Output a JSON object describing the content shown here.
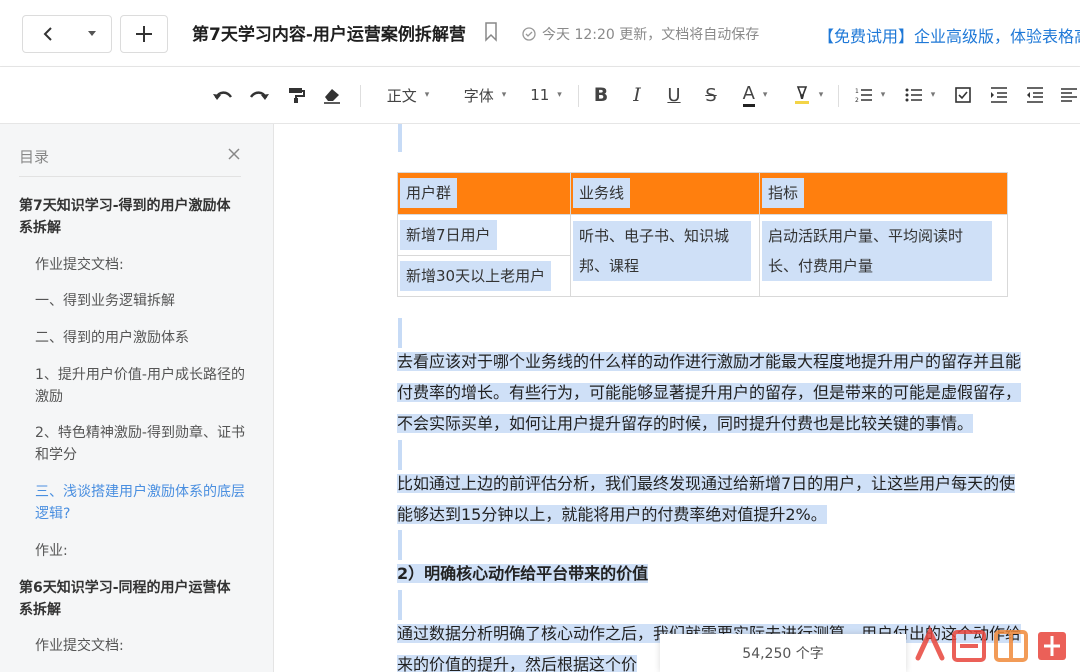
{
  "header": {
    "doc_title": "第7天学习内容-用户运营案例拆解营",
    "save_status": "今天 12:20 更新，文档将自动保存",
    "promo": "【免费试用】企业高级版，体验表格高"
  },
  "toolbar": {
    "style_label": "正文",
    "font_label": "字体",
    "size_label": "11",
    "bold": "B",
    "italic": "I",
    "underline": "U",
    "strike": "S",
    "font_color": "A"
  },
  "toc": {
    "title": "目录",
    "items": [
      "第7天知识学习-得到的用户激励体系拆解",
      "作业提交文档:",
      "一、得到业务逻辑拆解",
      "二、得到的用户激励体系",
      "1、提升用户价值-用户成长路径的激励",
      "2、特色精神激励-得到勋章、证书和学分",
      "三、浅谈搭建用户激励体系的底层逻辑?",
      "作业:",
      "第6天知识学习-同程的用户运营体系拆解",
      "作业提交文档:"
    ]
  },
  "table": {
    "headers": [
      "用户群",
      "业务线",
      "指标"
    ],
    "rows": [
      [
        "新增7日用户",
        "听书、电子书、知识城邦、课程",
        "启动活跃用户量、平均阅读时长、付费用户量"
      ],
      [
        "新增30天以上老用户"
      ]
    ]
  },
  "body": {
    "p1": [
      "去看应该对于哪个业务线的什么样的动作进行激励才能最大程度地提升用户的留存并且能",
      "付费率的增长。有些行为，可能能够显著提升用户的留存，但是带来的可能是虚假留存，",
      "不会实际买单，如何让用户提升留存的时候，同时提升付费也是比较关键的事情。"
    ],
    "p2": [
      "比如通过上边的前评估分析，我们最终发现通过给新增7日的用户，让这些用户每天的使",
      "能够达到15分钟以上，就能将用户的付费率绝对值提升2%。"
    ],
    "heading": "2）明确核心动作给平台带来的价值",
    "p3": [
      "通过数据分析明确了核心动作之后，我们就需要实际去进行测算，用户付出的这个动作给",
      "来的价值的提升，然后根据这个价"
    ]
  },
  "status": {
    "word_count": "54,250 个字"
  },
  "watermark": "人人都是产品经理"
}
